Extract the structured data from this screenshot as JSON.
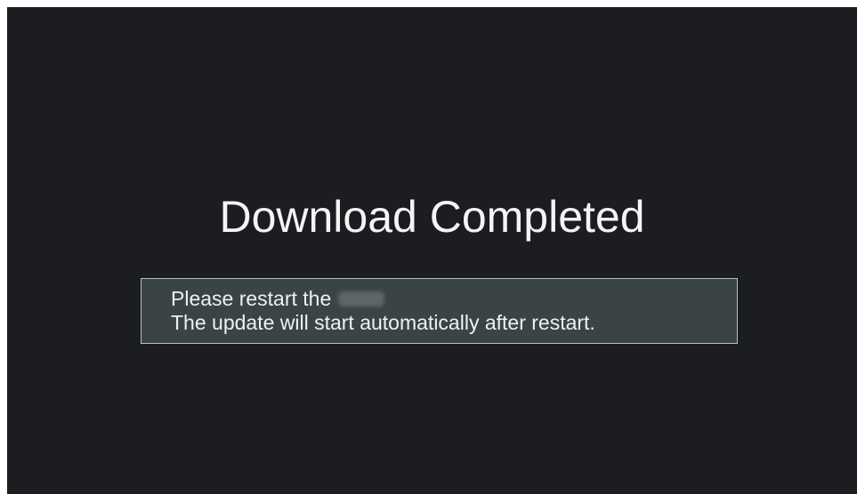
{
  "dialog": {
    "title": "Download Completed",
    "line1": "Please restart the",
    "line2": "The update will start automatically after restart."
  },
  "colors": {
    "background": "#1b1d21",
    "message_box": "#3a4447",
    "message_border": "#b9bfc1",
    "text": "#f4f4f4"
  }
}
